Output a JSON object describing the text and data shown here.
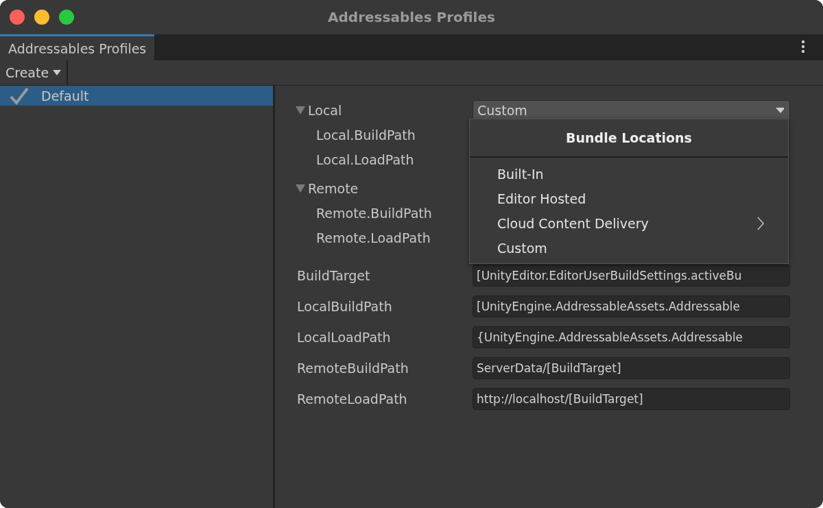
{
  "window": {
    "title": "Addressables Profiles"
  },
  "tabs": [
    {
      "label": "Addressables Profiles",
      "selected": true
    }
  ],
  "toolbar": {
    "create_button": "Create"
  },
  "profiles": [
    {
      "name": "Default",
      "selected": true,
      "checked": true
    }
  ],
  "groups": [
    {
      "name": "Local",
      "expanded": true,
      "dropdown": "Custom",
      "children": [
        {
          "name": "Local.BuildPath"
        },
        {
          "name": "Local.LoadPath"
        }
      ]
    },
    {
      "name": "Remote",
      "expanded": true,
      "children": [
        {
          "name": "Remote.BuildPath"
        },
        {
          "name": "Remote.LoadPath"
        }
      ]
    }
  ],
  "variables": [
    {
      "label": "BuildTarget",
      "value": "[UnityEditor.EditorUserBuildSettings.activeBu"
    },
    {
      "label": "LocalBuildPath",
      "value": "[UnityEngine.AddressableAssets.Addressable"
    },
    {
      "label": "LocalLoadPath",
      "value": "{UnityEngine.AddressableAssets.Addressable"
    },
    {
      "label": "RemoteBuildPath",
      "value": "ServerData/[BuildTarget]"
    },
    {
      "label": "RemoteLoadPath",
      "value": "http://localhost/[BuildTarget]"
    }
  ],
  "popup": {
    "title": "Bundle Locations",
    "items": [
      {
        "label": "Built-In",
        "submenu": false
      },
      {
        "label": "Editor Hosted",
        "submenu": false
      },
      {
        "label": "Cloud Content Delivery",
        "submenu": true
      },
      {
        "label": "Custom",
        "submenu": false
      }
    ]
  }
}
